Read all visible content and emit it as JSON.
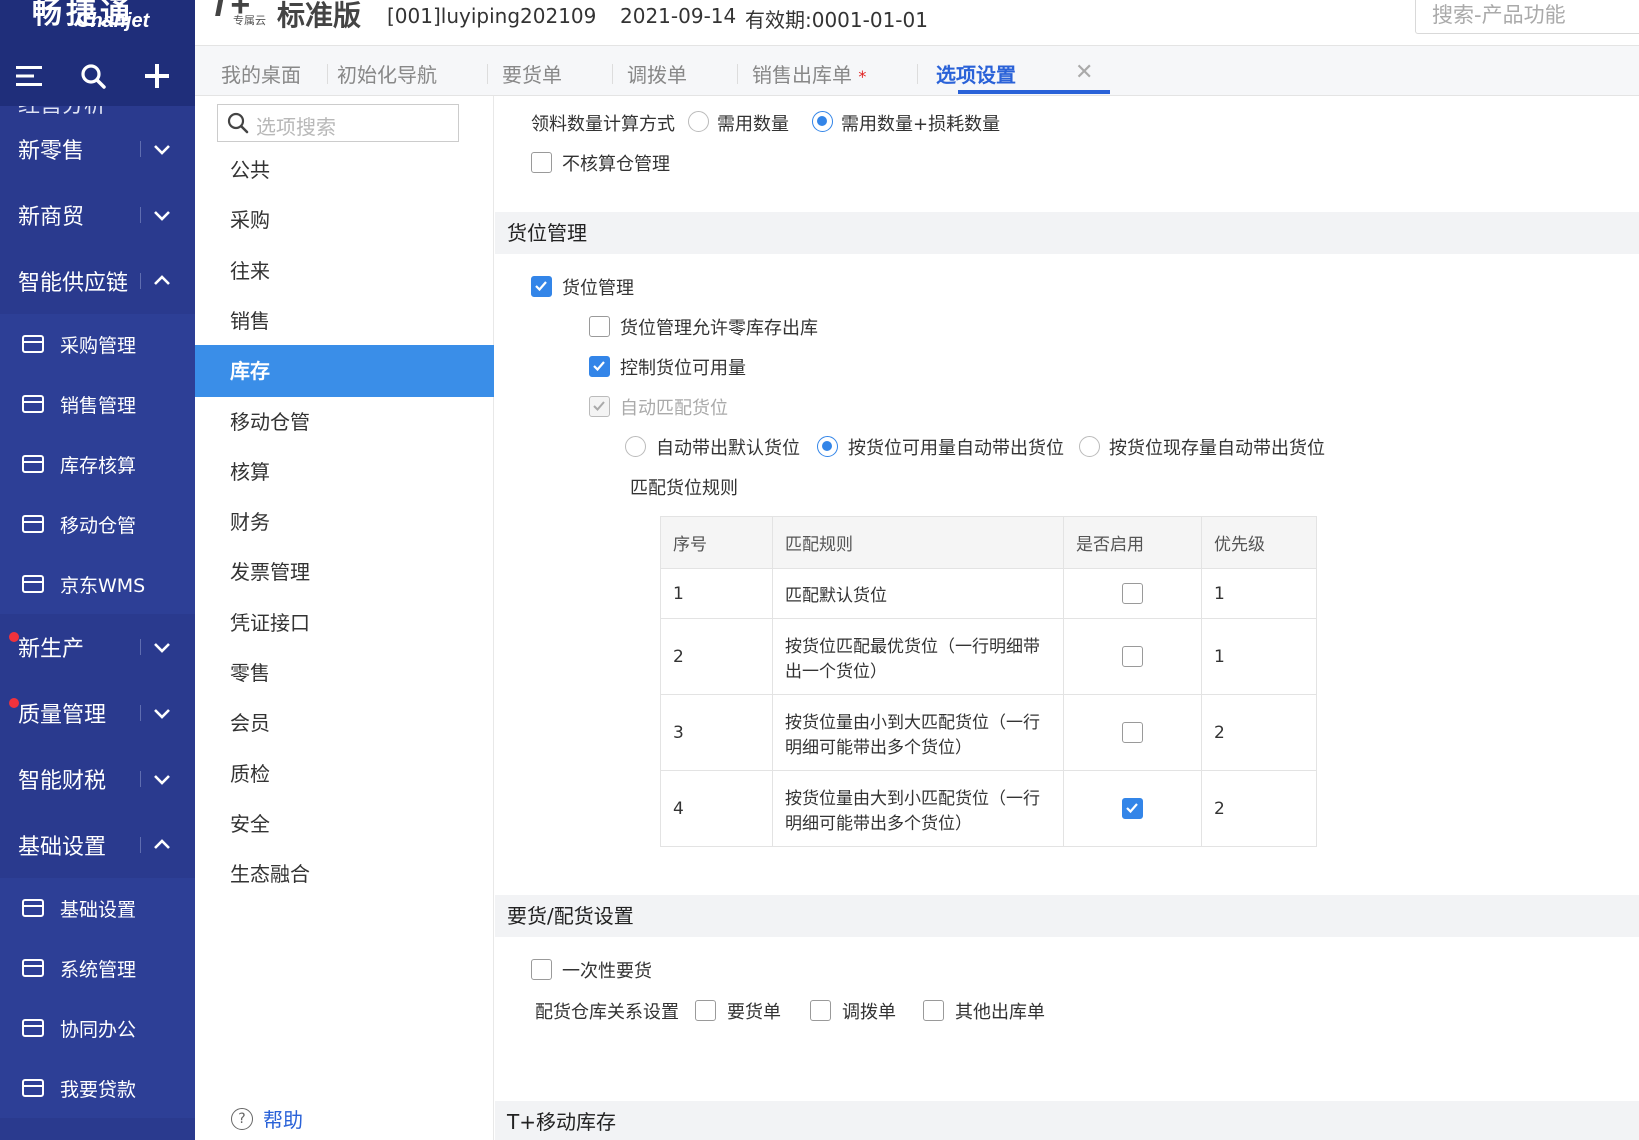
{
  "nav": {
    "logo_cn": "畅捷通",
    "logo_en": "Chanjet",
    "cut_item": "经营分析",
    "groups_top": [
      {
        "label": "新零售",
        "expanded": false
      },
      {
        "label": "新商贸",
        "expanded": false
      },
      {
        "label": "智能供应链",
        "expanded": true
      }
    ],
    "supply_items": [
      {
        "label": "采购管理",
        "icon": "cart-icon"
      },
      {
        "label": "销售管理",
        "icon": "sales-chart-icon"
      },
      {
        "label": "库存核算",
        "icon": "warehouse-icon"
      },
      {
        "label": "移动仓管",
        "icon": "mobile-warehouse-icon"
      },
      {
        "label": "京东WMS",
        "icon": "truck-icon"
      }
    ],
    "groups_mid": [
      {
        "label": "新生产",
        "expanded": false,
        "dot": true
      },
      {
        "label": "质量管理",
        "expanded": false,
        "dot": true
      },
      {
        "label": "智能财税",
        "expanded": false,
        "dot": false
      },
      {
        "label": "基础设置",
        "expanded": true,
        "dot": false
      }
    ],
    "base_items": [
      {
        "label": "基础设置",
        "icon": "gear-icon"
      },
      {
        "label": "系统管理",
        "icon": "monitor-icon"
      },
      {
        "label": "协同办公",
        "icon": "collaboration-icon"
      },
      {
        "label": "我要贷款",
        "icon": "loan-icon"
      }
    ]
  },
  "topbar": {
    "product_mark": "T+",
    "product_sub": "专属云",
    "edition": "标准版",
    "account": "[001]luyiping202109",
    "date": "2021-09-14",
    "valid": "有效期:0001-01-01",
    "search_placeholder": "搜索-产品功能"
  },
  "tabs": [
    {
      "label": "我的桌面",
      "active": false,
      "modified": false
    },
    {
      "label": "初始化导航",
      "active": false,
      "modified": false
    },
    {
      "label": "要货单",
      "active": false,
      "modified": false
    },
    {
      "label": "调拨单",
      "active": false,
      "modified": false
    },
    {
      "label": "销售出库单",
      "active": false,
      "modified": true
    },
    {
      "label": "选项设置",
      "active": true,
      "modified": false
    }
  ],
  "options_sidebar": {
    "search_placeholder": "选项搜索",
    "items": [
      "公共",
      "采购",
      "往来",
      "销售",
      "库存",
      "移动仓管",
      "核算",
      "财务",
      "发票管理",
      "凭证接口",
      "零售",
      "会员",
      "质检",
      "安全",
      "生态融合"
    ],
    "active_index": 4,
    "help": "帮助"
  },
  "main": {
    "material_calc_label": "领料数量计算方式",
    "material_calc_options": [
      {
        "label": "需用数量",
        "selected": false
      },
      {
        "label": "需用数量+损耗数量",
        "selected": true
      }
    ],
    "no_warehouse_accounting": {
      "label": "不核算仓管理",
      "checked": false
    },
    "location_section": "货位管理",
    "location_mgmt": {
      "label": "货位管理",
      "checked": true
    },
    "allow_zero_stock": {
      "label": "货位管理允许零库存出库",
      "checked": false
    },
    "control_available": {
      "label": "控制货位可用量",
      "checked": true
    },
    "auto_match": {
      "label": "自动匹配货位",
      "checked": true,
      "disabled": true
    },
    "auto_options": [
      {
        "label": "自动带出默认货位",
        "selected": false
      },
      {
        "label": "按货位可用量自动带出货位",
        "selected": true
      },
      {
        "label": "按货位现存量自动带出货位",
        "selected": false
      }
    ],
    "rules_title": "匹配货位规则",
    "rules_headers": [
      "序号",
      "匹配规则",
      "是否启用",
      "优先级"
    ],
    "rules": [
      {
        "no": "1",
        "rule": "匹配默认货位",
        "enabled": false,
        "priority": "1"
      },
      {
        "no": "2",
        "rule": "按货位匹配最优货位（一行明细带出一个货位）",
        "enabled": false,
        "priority": "1"
      },
      {
        "no": "3",
        "rule": "按货位量由小到大匹配货位（一行明细可能带出多个货位）",
        "enabled": false,
        "priority": "2"
      },
      {
        "no": "4",
        "rule": "按货位量由大到小匹配货位（一行明细可能带出多个货位）",
        "enabled": true,
        "priority": "2"
      }
    ],
    "requisition_section": "要货/配货设置",
    "one_time_requisition": {
      "label": "一次性要货",
      "checked": false
    },
    "dist_relation_label": "配货仓库关系设置",
    "dist_options": [
      {
        "label": "要货单",
        "checked": false
      },
      {
        "label": "调拨单",
        "checked": false
      },
      {
        "label": "其他出库单",
        "checked": false
      }
    ],
    "mobile_section": "T+移动库存"
  },
  "colors": {
    "nav_bg": "#2a3a8e",
    "accent": "#2a62d8",
    "active_item": "#3a8ee8",
    "checkbox_on": "#3385e8",
    "notify_dot": "#f0323c"
  }
}
